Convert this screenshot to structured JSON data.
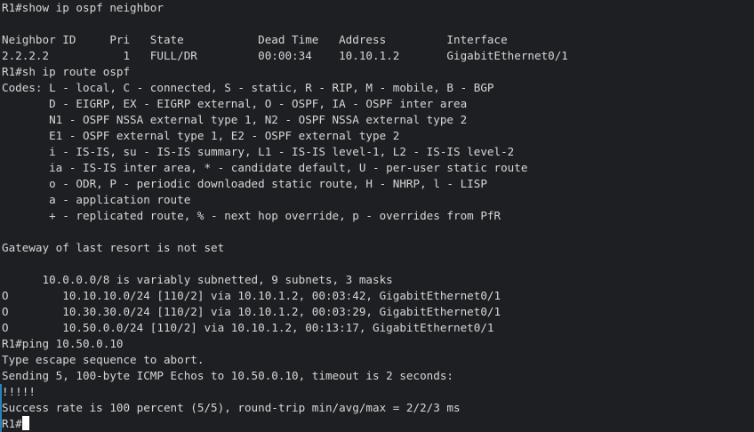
{
  "terminal": {
    "lines": [
      "R1#show ip ospf neighbor",
      "",
      "Neighbor ID     Pri   State           Dead Time   Address         Interface",
      "2.2.2.2           1   FULL/DR         00:00:34    10.10.1.2       GigabitEthernet0/1",
      "R1#sh ip route ospf",
      "Codes: L - local, C - connected, S - static, R - RIP, M - mobile, B - BGP",
      "       D - EIGRP, EX - EIGRP external, O - OSPF, IA - OSPF inter area",
      "       N1 - OSPF NSSA external type 1, N2 - OSPF NSSA external type 2",
      "       E1 - OSPF external type 1, E2 - OSPF external type 2",
      "       i - IS-IS, su - IS-IS summary, L1 - IS-IS level-1, L2 - IS-IS level-2",
      "       ia - IS-IS inter area, * - candidate default, U - per-user static route",
      "       o - ODR, P - periodic downloaded static route, H - NHRP, l - LISP",
      "       a - application route",
      "       + - replicated route, % - next hop override, p - overrides from PfR",
      "",
      "Gateway of last resort is not set",
      "",
      "      10.0.0.0/8 is variably subnetted, 9 subnets, 3 masks",
      "O        10.10.10.0/24 [110/2] via 10.10.1.2, 00:03:42, GigabitEthernet0/1",
      "O        10.30.30.0/24 [110/2] via 10.10.1.2, 00:03:29, GigabitEthernet0/1",
      "O        10.50.0.0/24 [110/2] via 10.10.1.2, 00:13:17, GigabitEthernet0/1",
      "R1#ping 10.50.0.10",
      "Type escape sequence to abort.",
      "Sending 5, 100-byte ICMP Echos to 10.50.0.10, timeout is 2 seconds:",
      "!!!!!",
      "Success rate is 100 percent (5/5), round-trip min/avg/max = 2/2/3 ms"
    ],
    "prompt": "R1#"
  },
  "colors": {
    "background": "#1e1f22",
    "foreground": "#d7d7d7",
    "gutter_accent": "#2f7fb8",
    "cursor": "#ffffff"
  }
}
